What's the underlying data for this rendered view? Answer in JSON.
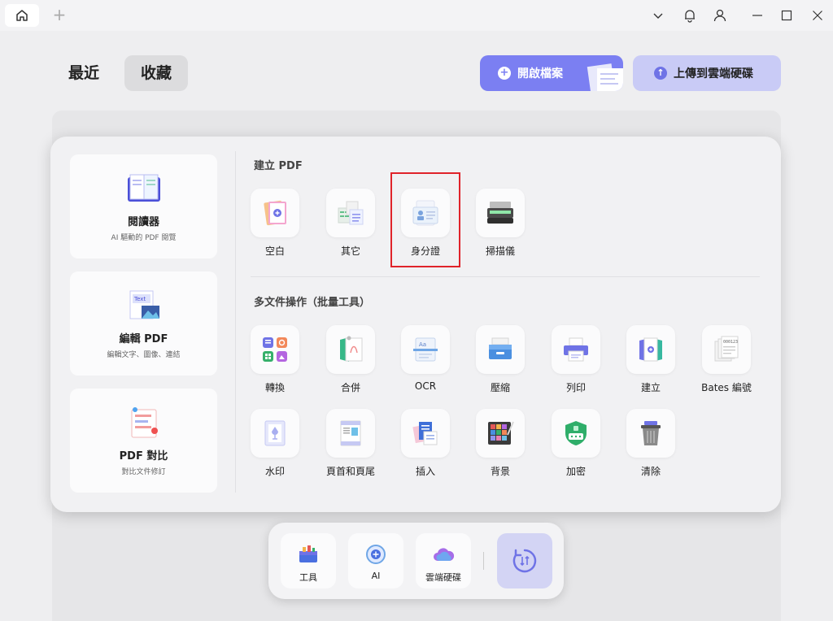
{
  "header": {
    "tab_recent": "最近",
    "tab_favorites": "收藏",
    "open_file": "開啟檔案",
    "upload_cloud": "上傳到雲端硬碟"
  },
  "sidebar": {
    "items": [
      {
        "title": "閱讀器",
        "subtitle": "AI 驅動的 PDF 閱覽"
      },
      {
        "title": "編輯 PDF",
        "subtitle": "編輯文字、圖像、連結"
      },
      {
        "title": "PDF 對比",
        "subtitle": "對比文件修訂"
      }
    ]
  },
  "create_section": {
    "title": "建立 PDF",
    "items": [
      {
        "label": "空白",
        "icon": "blank-doc-icon"
      },
      {
        "label": "其它",
        "icon": "other-docs-icon"
      },
      {
        "label": "身分證",
        "icon": "id-card-icon"
      },
      {
        "label": "掃描儀",
        "icon": "scanner-icon"
      }
    ]
  },
  "batch_section": {
    "title": "多文件操作（批量工具）",
    "items": [
      {
        "label": "轉換",
        "icon": "convert-icon"
      },
      {
        "label": "合併",
        "icon": "combine-icon"
      },
      {
        "label": "OCR",
        "icon": "ocr-icon"
      },
      {
        "label": "壓縮",
        "icon": "compress-icon"
      },
      {
        "label": "列印",
        "icon": "print-icon"
      },
      {
        "label": "建立",
        "icon": "create-icon"
      },
      {
        "label": "Bates 編號",
        "icon": "bates-icon"
      },
      {
        "label": "水印",
        "icon": "watermark-icon"
      },
      {
        "label": "頁首和頁尾",
        "icon": "header-footer-icon"
      },
      {
        "label": "插入",
        "icon": "insert-icon"
      },
      {
        "label": "背景",
        "icon": "background-icon"
      },
      {
        "label": "加密",
        "icon": "encrypt-icon"
      },
      {
        "label": "清除",
        "icon": "clear-icon"
      }
    ]
  },
  "dock": {
    "tools": "工具",
    "ai": "AI",
    "cloud": "雲端硬碟"
  },
  "colors": {
    "accent": "#7b7ff2",
    "accent_light": "#c9cbf6",
    "highlight": "#e0232a"
  }
}
